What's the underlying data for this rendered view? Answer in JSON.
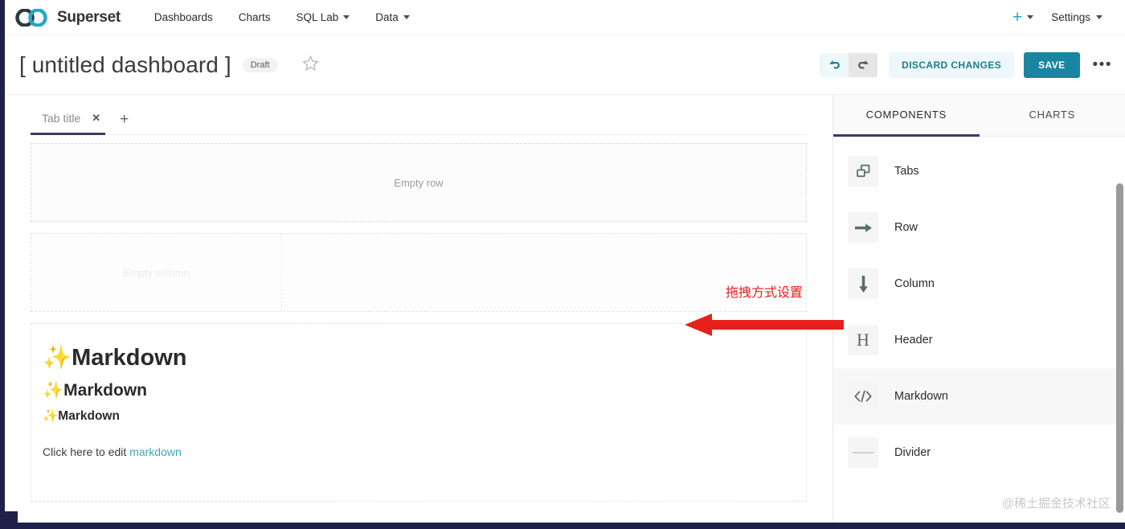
{
  "navbar": {
    "brand": "Superset",
    "links": [
      {
        "label": "Dashboards",
        "caret": false
      },
      {
        "label": "Charts",
        "caret": false
      },
      {
        "label": "SQL Lab",
        "caret": true
      },
      {
        "label": "Data",
        "caret": true
      }
    ],
    "plus_label": "+",
    "settings_label": "Settings"
  },
  "dashboard_header": {
    "title": "[ untitled dashboard ]",
    "badge": "Draft",
    "star": "☆",
    "undo": "↩",
    "redo": "↪",
    "discard_label": "DISCARD CHANGES",
    "save_label": "SAVE",
    "more": "•••"
  },
  "canvas": {
    "tab": {
      "label": "Tab title",
      "close": "✕",
      "add": "+"
    },
    "empty_row_text": "Empty row",
    "empty_column_text": "Empty column",
    "markdown": {
      "h1": "✨Markdown",
      "h2": "✨Markdown",
      "h3": "✨Markdown",
      "note_prefix": "Click here to edit ",
      "note_link": "markdown"
    }
  },
  "side_panel": {
    "tabs": [
      {
        "label": "COMPONENTS",
        "active": true
      },
      {
        "label": "CHARTS",
        "active": false
      }
    ],
    "items": [
      {
        "label": "Tabs",
        "icon": "tabs-icon",
        "hover": false
      },
      {
        "label": "Row",
        "icon": "row-icon",
        "hover": false
      },
      {
        "label": "Column",
        "icon": "column-icon",
        "hover": false
      },
      {
        "label": "Header",
        "icon": "header-icon",
        "hover": false
      },
      {
        "label": "Markdown",
        "icon": "markdown-icon",
        "hover": true
      },
      {
        "label": "Divider",
        "icon": "divider-icon",
        "hover": false
      }
    ]
  },
  "annotations": {
    "drag_note": "拖拽方式设置",
    "watermark": "@稀土掘金技术社区"
  },
  "colors": {
    "accent_teal": "#20a7c9",
    "save_bg": "#1a85a0",
    "annotation_red": "#e8201c",
    "tab_underline": "#3a3a6e"
  }
}
